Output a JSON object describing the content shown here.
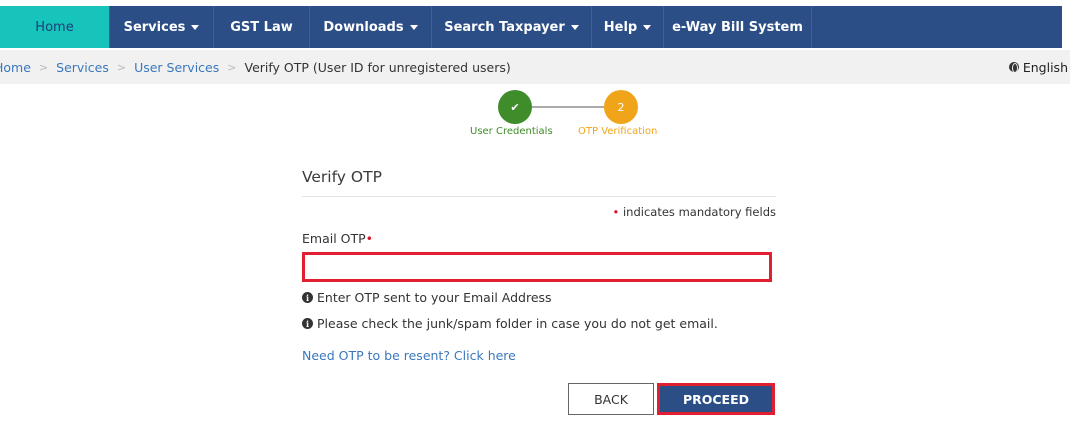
{
  "nav": {
    "items": [
      {
        "label": "Home"
      },
      {
        "label": "Services"
      },
      {
        "label": "GST Law"
      },
      {
        "label": "Downloads"
      },
      {
        "label": "Search Taxpayer"
      },
      {
        "label": "Help"
      },
      {
        "label": "e-Way Bill System"
      }
    ]
  },
  "breadcrumb": {
    "items": [
      "Home",
      "Services",
      "User Services"
    ],
    "current": "Verify OTP (User ID for unregistered users)"
  },
  "language": "English",
  "stepper": {
    "steps": [
      {
        "label": "User Credentials",
        "marker": "✔",
        "status": "completed"
      },
      {
        "label": "OTP Verification",
        "marker": "2",
        "status": "active"
      }
    ]
  },
  "form": {
    "title": "Verify OTP",
    "mandatory_star": "•",
    "mandatory_note": "indicates mandatory fields",
    "email_otp_label": "Email OTP",
    "email_otp_value": "",
    "hint_1": "Enter OTP sent to your Email Address",
    "hint_2": "Please check the junk/spam folder in case you do not get email.",
    "resend_link": "Need OTP to be resent? Click here"
  },
  "buttons": {
    "back": "BACK",
    "proceed": "PROCEED"
  },
  "colors": {
    "nav_bg": "#2c4e86",
    "nav_active_bg": "#17c4bb",
    "step_done": "#3e8c2a",
    "step_active": "#f0a419",
    "highlight": "#e02030",
    "link": "#3a78bd"
  }
}
